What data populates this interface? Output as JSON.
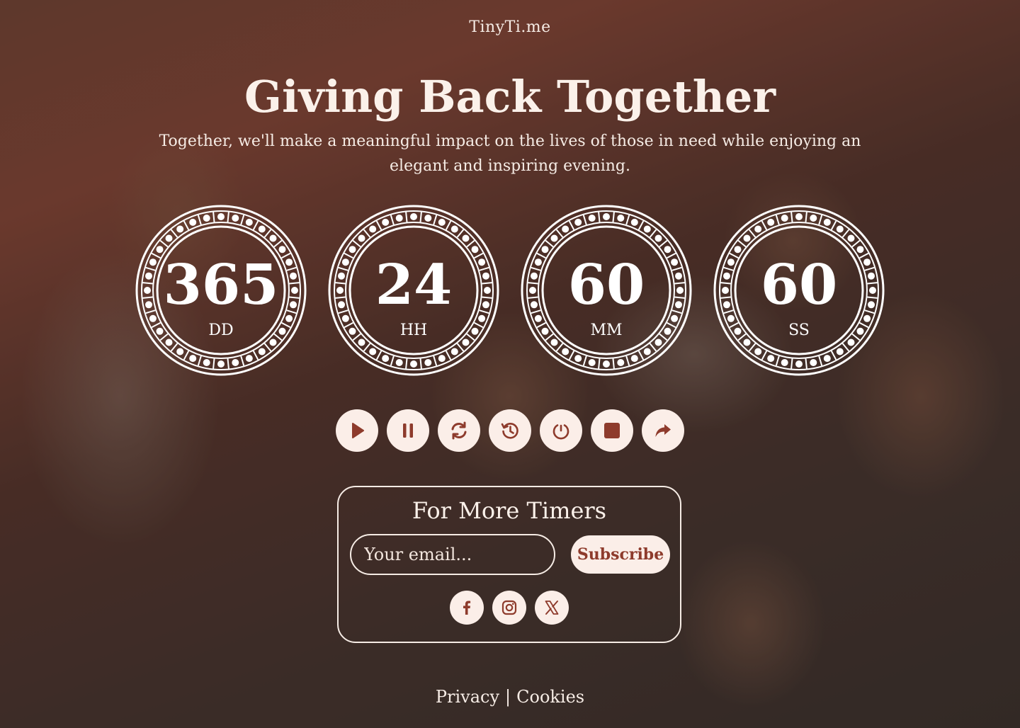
{
  "brand": "TinyTi.me",
  "hero": {
    "title": "Giving Back Together",
    "subtitle": "Together, we'll make a meaningful impact on the lives of those in need while enjoying an elegant and inspiring evening."
  },
  "countdown": [
    {
      "value": "365",
      "unit": "DD"
    },
    {
      "value": "24",
      "unit": "HH"
    },
    {
      "value": "60",
      "unit": "MM"
    },
    {
      "value": "60",
      "unit": "SS"
    }
  ],
  "controls": [
    {
      "name": "play-button",
      "icon": "play-icon"
    },
    {
      "name": "pause-button",
      "icon": "pause-icon"
    },
    {
      "name": "restart-button",
      "icon": "refresh-icon"
    },
    {
      "name": "history-button",
      "icon": "history-icon"
    },
    {
      "name": "reset-button",
      "icon": "reset-icon"
    },
    {
      "name": "stop-button",
      "icon": "stop-icon"
    },
    {
      "name": "share-button",
      "icon": "share-icon"
    }
  ],
  "subscribe": {
    "title": "For More Timers",
    "email_placeholder": "Your email...",
    "button_label": "Subscribe"
  },
  "socials": [
    {
      "name": "facebook-link",
      "icon": "facebook-icon"
    },
    {
      "name": "instagram-link",
      "icon": "instagram-icon"
    },
    {
      "name": "x-link",
      "icon": "x-icon"
    }
  ],
  "footer": {
    "privacy": "Privacy",
    "separator": "|",
    "cookies": "Cookies"
  },
  "colors": {
    "accent": "#8e3b2c",
    "button_bg": "#fbeee8",
    "text": "#fbf1ea"
  }
}
